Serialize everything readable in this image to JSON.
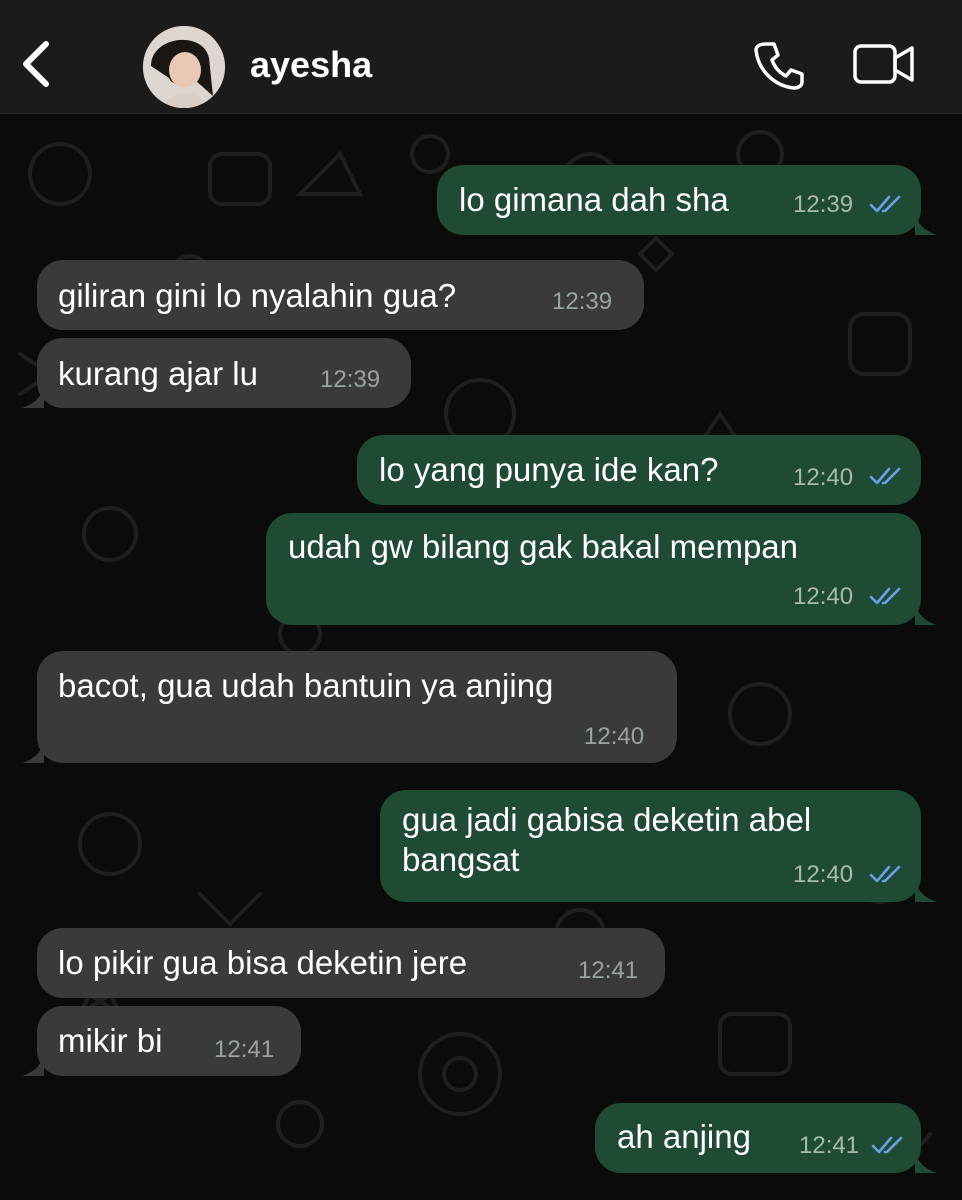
{
  "header": {
    "contact_name": "ayesha",
    "back_icon": "chevron-left-icon",
    "call_icon": "phone-icon",
    "video_icon": "video-camera-icon"
  },
  "colors": {
    "incoming_bubble": "#3a3a3c",
    "outgoing_bubble": "#1f4a33",
    "read_ticks": "#6aa0e6",
    "background": "#0b0b0b"
  },
  "messages": [
    {
      "dir": "out",
      "text": "lo gimana dah sha",
      "time": "12:39",
      "read": true
    },
    {
      "dir": "in",
      "text": "giliran gini lo nyalahin gua?",
      "time": "12:39"
    },
    {
      "dir": "in",
      "text": "kurang ajar lu",
      "time": "12:39"
    },
    {
      "dir": "out",
      "text": "lo yang punya ide kan?",
      "time": "12:40",
      "read": true
    },
    {
      "dir": "out",
      "text": "udah gw bilang gak bakal mempan",
      "time": "12:40",
      "read": true
    },
    {
      "dir": "in",
      "text": "bacot, gua udah bantuin ya anjing",
      "time": "12:40"
    },
    {
      "dir": "out",
      "text": "gua jadi gabisa deketin abel\nbangsat",
      "time": "12:40",
      "read": true
    },
    {
      "dir": "in",
      "text": "lo pikir gua bisa deketin jere",
      "time": "12:41"
    },
    {
      "dir": "in",
      "text": "mikir bi",
      "time": "12:41"
    },
    {
      "dir": "out",
      "text": "ah anjing",
      "time": "12:41",
      "read": true
    }
  ]
}
